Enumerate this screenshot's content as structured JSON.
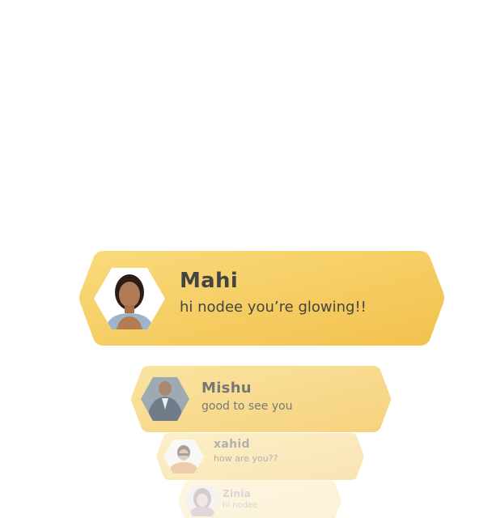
{
  "notifications": [
    {
      "id": "mahi",
      "name": "Mahi",
      "message": "hi nodee you’re glowing!!"
    },
    {
      "id": "mishu",
      "name": "Mishu",
      "message": "good to see you"
    },
    {
      "id": "xahid",
      "name": "xahid",
      "message": "how are you??"
    },
    {
      "id": "zinia",
      "name": "Zinia",
      "message": "hi nodee"
    }
  ],
  "colors": {
    "card_fill_light": "#f9d97a",
    "card_fill_dark": "#f3c24e",
    "text": "#444444",
    "background": "#ffffff"
  }
}
